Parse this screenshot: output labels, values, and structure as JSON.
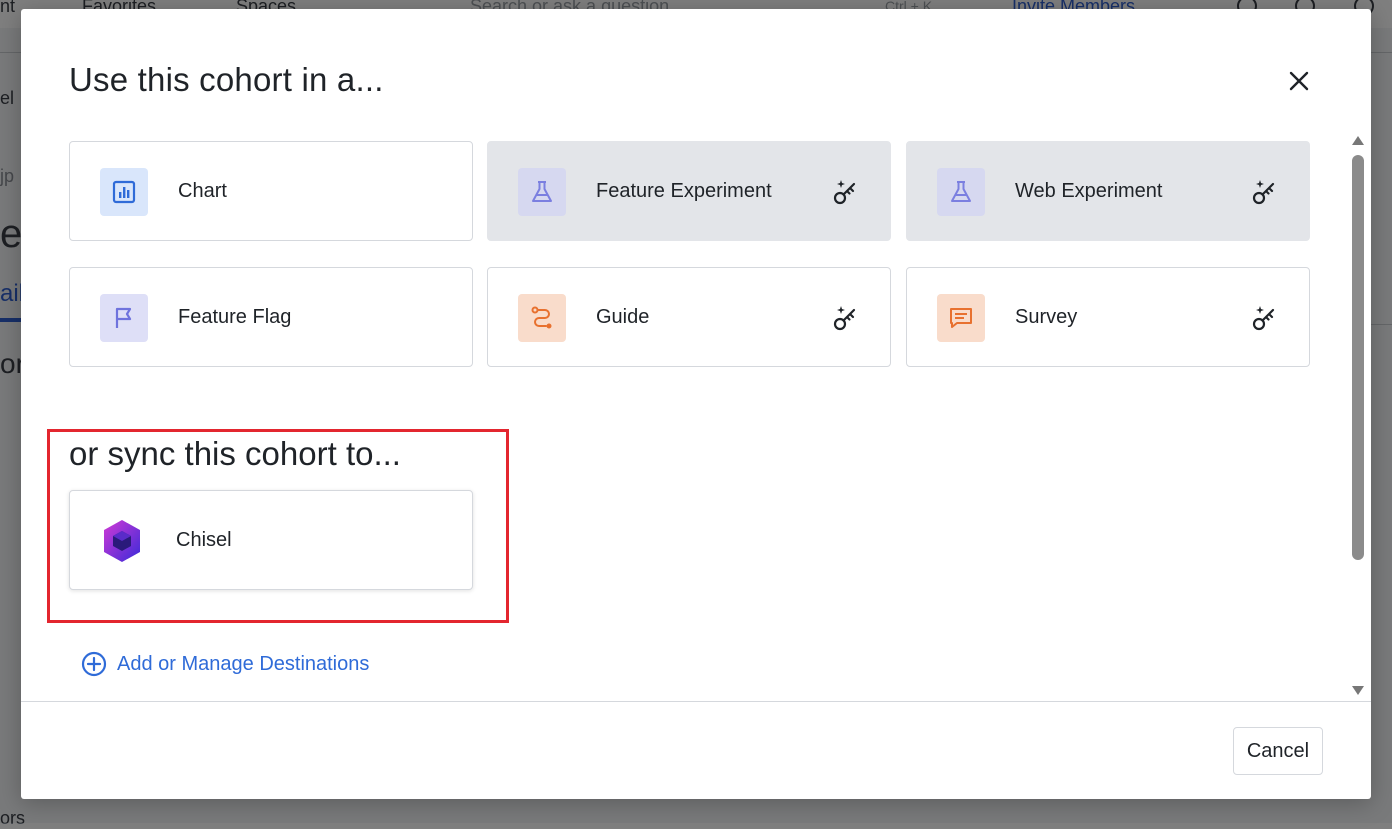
{
  "background": {
    "topbar_items": [
      "nt",
      "Favorites",
      "Spaces",
      "Search or ask a question",
      "Ctrl + K",
      "Invite Members"
    ],
    "side_fragments": [
      "el",
      "jp",
      "e",
      "ail",
      "or",
      "ors"
    ]
  },
  "modal": {
    "title": "Use this cohort in a...",
    "close_label": "×",
    "use_options": [
      {
        "label": "Chart",
        "icon": "chart-icon",
        "locked": false
      },
      {
        "label": "Feature Experiment",
        "icon": "flask-icon",
        "locked": true
      },
      {
        "label": "Web Experiment",
        "icon": "flask-icon",
        "locked": true
      },
      {
        "label": "Feature Flag",
        "icon": "flag-icon",
        "locked": false
      },
      {
        "label": "Guide",
        "icon": "route-icon",
        "locked": true
      },
      {
        "label": "Survey",
        "icon": "message-icon",
        "locked": true
      }
    ],
    "sync_title": "or sync this cohort to...",
    "sync_destinations": [
      {
        "label": "Chisel",
        "icon": "chisel-logo-icon"
      }
    ],
    "add_destinations_label": "Add or Manage Destinations",
    "cancel_label": "Cancel"
  },
  "colors": {
    "accent_blue": "#2f6bd8",
    "highlight_red": "#e3262f",
    "disabled_card": "#e3e5e9"
  }
}
